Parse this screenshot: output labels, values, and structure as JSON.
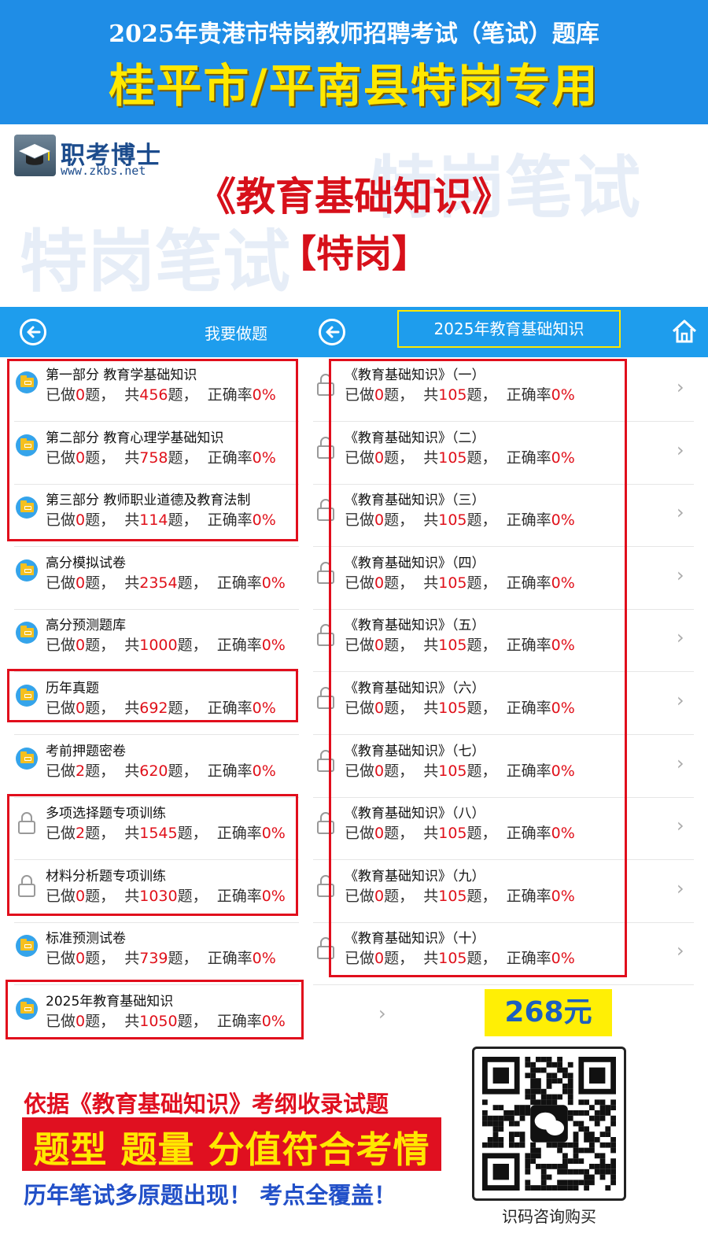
{
  "banner": {
    "line1": "2025年贵港市特岗教师招聘考试（笔试）题库",
    "line2": "桂平市/平南县特岗专用"
  },
  "watermark": "特岗笔试",
  "logo": {
    "name": "职考博士",
    "url": "www.zkbs.net"
  },
  "book_title": "《教育基础知识》",
  "book_subtitle": "【特岗】",
  "appbar": {
    "left_title": "我要做题",
    "right_title": "2025年教育基础知识"
  },
  "stat_labels": {
    "done": "已做",
    "q": "题，",
    "total": "共",
    "rate": "正确率"
  },
  "left_list": [
    {
      "name": "第一部分 教育学基础知识",
      "done": "0",
      "total": "456",
      "rate": "0%",
      "locked": false
    },
    {
      "name": "第二部分 教育心理学基础知识",
      "done": "0",
      "total": "758",
      "rate": "0%",
      "locked": false
    },
    {
      "name": "第三部分 教师职业道德及教育法制",
      "done": "0",
      "total": "114",
      "rate": "0%",
      "locked": false
    },
    {
      "name": "高分模拟试卷",
      "done": "0",
      "total": "2354",
      "rate": "0%",
      "locked": false
    },
    {
      "name": "高分预测题库",
      "done": "0",
      "total": "1000",
      "rate": "0%",
      "locked": false
    },
    {
      "name": "历年真题",
      "done": "0",
      "total": "692",
      "rate": "0%",
      "locked": false
    },
    {
      "name": "考前押题密卷",
      "done": "2",
      "total": "620",
      "rate": "0%",
      "locked": false
    },
    {
      "name": "多项选择题专项训练",
      "done": "2",
      "total": "1545",
      "rate": "0%",
      "locked": true
    },
    {
      "name": "材料分析题专项训练",
      "done": "0",
      "total": "1030",
      "rate": "0%",
      "locked": true
    },
    {
      "name": "标准预测试卷",
      "done": "0",
      "total": "739",
      "rate": "0%",
      "locked": false
    },
    {
      "name": "2025年教育基础知识",
      "done": "0",
      "total": "1050",
      "rate": "0%",
      "locked": false
    }
  ],
  "right_list": [
    {
      "name": "《教育基础知识》（一）",
      "done": "0",
      "total": "105",
      "rate": "0%"
    },
    {
      "name": "《教育基础知识》（二）",
      "done": "0",
      "total": "105",
      "rate": "0%"
    },
    {
      "name": "《教育基础知识》（三）",
      "done": "0",
      "total": "105",
      "rate": "0%"
    },
    {
      "name": "《教育基础知识》（四）",
      "done": "0",
      "total": "105",
      "rate": "0%"
    },
    {
      "name": "《教育基础知识》（五）",
      "done": "0",
      "total": "105",
      "rate": "0%"
    },
    {
      "name": "《教育基础知识》（六）",
      "done": "0",
      "total": "105",
      "rate": "0%"
    },
    {
      "name": "《教育基础知识》（七）",
      "done": "0",
      "total": "105",
      "rate": "0%"
    },
    {
      "name": "《教育基础知识》（八）",
      "done": "0",
      "total": "105",
      "rate": "0%"
    },
    {
      "name": "《教育基础知识》（九）",
      "done": "0",
      "total": "105",
      "rate": "0%"
    },
    {
      "name": "《教育基础知识》（十）",
      "done": "0",
      "total": "105",
      "rate": "0%"
    }
  ],
  "price": "268元",
  "qr_caption": "识码咨询购买",
  "promo": {
    "line1": "依据《教育基础知识》考纲收录试题",
    "line2": "题型 题量 分值符合考情",
    "line3": "历年笔试多原题出现！ 考点全覆盖！"
  },
  "colors": {
    "banner": "#1f8de6",
    "appbar": "#1e9ded",
    "accent_red": "#e10e1c",
    "highlight_yellow": "#ffe800"
  }
}
